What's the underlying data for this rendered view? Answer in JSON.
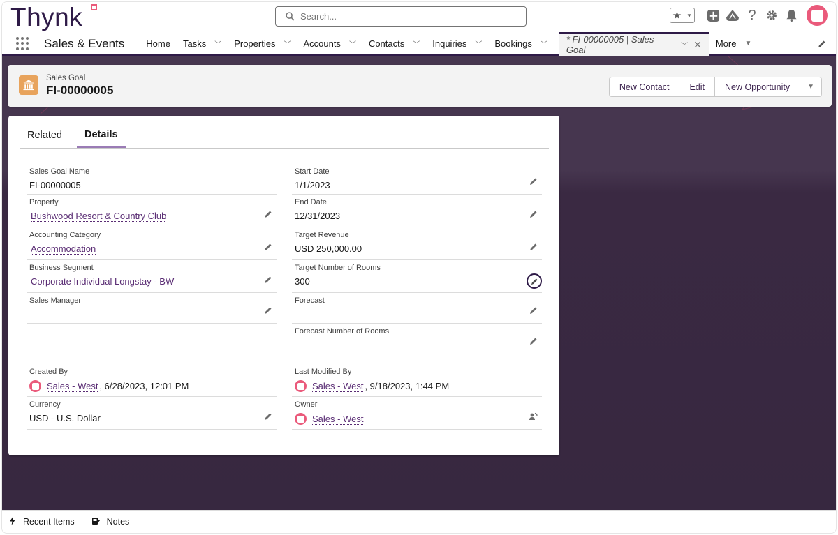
{
  "app": {
    "logo_text": "Thynk",
    "app_name": "Sales & Events",
    "brand_color": "#2e1a47",
    "accent_color": "#ea5a7b"
  },
  "header": {
    "search_placeholder": "Search...",
    "icons": [
      "favorites-star-icon",
      "favorites-dropdown-icon",
      "global-actions-plus-icon",
      "trailhead-icon",
      "help-icon",
      "setup-gear-icon",
      "notifications-bell-icon",
      "user-avatar"
    ]
  },
  "nav": {
    "items": [
      {
        "label": "Home",
        "has_menu": false
      },
      {
        "label": "Tasks",
        "has_menu": true
      },
      {
        "label": "Properties",
        "has_menu": true
      },
      {
        "label": "Accounts",
        "has_menu": true
      },
      {
        "label": "Contacts",
        "has_menu": true
      },
      {
        "label": "Inquiries",
        "has_menu": true
      },
      {
        "label": "Bookings",
        "has_menu": true
      }
    ],
    "active_tab": "* FI-00000005 | Sales Goal",
    "more_label": "More"
  },
  "record": {
    "type": "Sales Goal",
    "name": "FI-00000005",
    "icon": "bank-building-icon",
    "icon_color": "#e8a35c",
    "actions": [
      "New Contact",
      "Edit",
      "New Opportunity"
    ]
  },
  "tabs": [
    {
      "label": "Related",
      "active": false
    },
    {
      "label": "Details",
      "active": true
    }
  ],
  "fields": {
    "sales_goal_name": {
      "label": "Sales Goal Name",
      "value": "FI-00000005"
    },
    "start_date": {
      "label": "Start Date",
      "value": "1/1/2023"
    },
    "property": {
      "label": "Property",
      "value": "Bushwood Resort & Country Club"
    },
    "end_date": {
      "label": "End Date",
      "value": "12/31/2023"
    },
    "accounting_category": {
      "label": "Accounting Category",
      "value": "Accommodation"
    },
    "target_revenue": {
      "label": "Target Revenue",
      "value": "USD 250,000.00"
    },
    "business_segment": {
      "label": "Business Segment",
      "value": "Corporate Individual Longstay - BW"
    },
    "target_rooms": {
      "label": "Target Number of Rooms",
      "value": "300"
    },
    "sales_manager": {
      "label": "Sales Manager",
      "value": ""
    },
    "forecast": {
      "label": "Forecast",
      "value": ""
    },
    "forecast_rooms": {
      "label": "Forecast Number of Rooms",
      "value": ""
    },
    "created_by": {
      "label": "Created By",
      "user": "Sales - West",
      "timestamp": ", 6/28/2023, 12:01 PM"
    },
    "last_modified_by": {
      "label": "Last Modified By",
      "user": "Sales - West",
      "timestamp": ", 9/18/2023, 1:44 PM"
    },
    "currency": {
      "label": "Currency",
      "value": "USD - U.S. Dollar"
    },
    "owner": {
      "label": "Owner",
      "user": "Sales - West"
    }
  },
  "utility_bar": {
    "recent_items": "Recent Items",
    "notes": "Notes"
  }
}
